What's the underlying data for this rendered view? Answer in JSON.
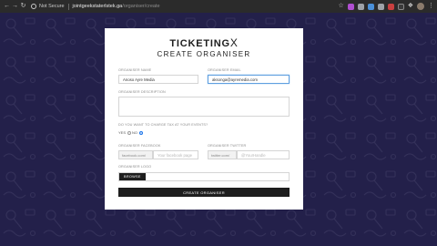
{
  "browser": {
    "security_label": "Not Secure",
    "url_host": "jointgeekstaterlstek.ga",
    "url_path": "/organiser/create"
  },
  "brand": {
    "logo_text": "TICKETING",
    "logo_suffix": "X",
    "background_color": "#23204a",
    "accent_color": "#1a73e8"
  },
  "page": {
    "title": "CREATE ORGANISER"
  },
  "form": {
    "organiser_name": {
      "label": "ORGANISER NAME",
      "value": "Anoso Ayre Media"
    },
    "organiser_email": {
      "label": "ORGANISER EMAIL",
      "value": "aksonga@ayremedia.com"
    },
    "organiser_description": {
      "label": "ORGANISER DESCRIPTION",
      "value": ""
    },
    "fee_question": {
      "label": "DO YOU WANT TO CHARGE TAX AT YOUR EVENTS?",
      "options": [
        "YES",
        "NO"
      ],
      "selected": "NO"
    },
    "organiser_facebook": {
      "label": "ORGANISER FACEBOOK",
      "prefix": "facebook.com/",
      "placeholder": "Your facebook page"
    },
    "organiser_twitter": {
      "label": "ORGANISER TWITTER",
      "prefix": "twitter.com/",
      "placeholder": "@YourHandle"
    },
    "organiser_logo": {
      "label": "ORGANISER LOGO",
      "browse_label": "BROWSE"
    },
    "submit_label": "Create Organiser"
  }
}
